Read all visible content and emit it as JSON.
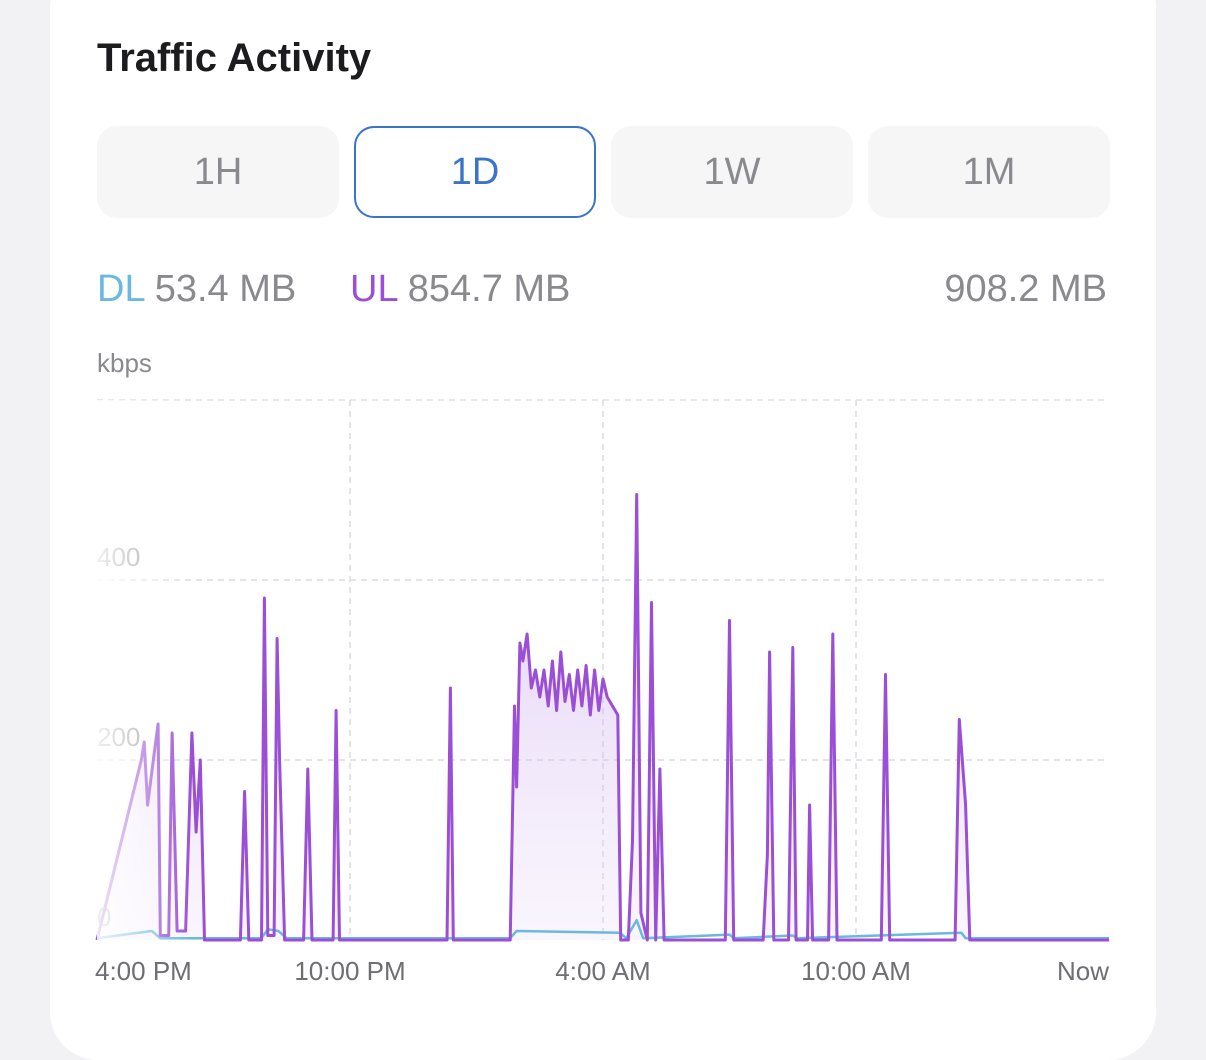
{
  "title": "Traffic Activity",
  "ranges": [
    {
      "label": "1H",
      "active": false
    },
    {
      "label": "1D",
      "active": true
    },
    {
      "label": "1W",
      "active": false
    },
    {
      "label": "1M",
      "active": false
    }
  ],
  "stats": {
    "dl_label": "DL",
    "dl_value": "53.4 MB",
    "ul_label": "UL",
    "ul_value": "854.7 MB",
    "total": "908.2 MB"
  },
  "colors": {
    "download": "#6bb8e0",
    "upload": "#9b4fd6",
    "active": "#3a74c9"
  },
  "chart_data": {
    "type": "area",
    "ylabel": "kbps",
    "ylim": [
      0,
      600
    ],
    "yticks": [
      0,
      200,
      400
    ],
    "xticks": [
      "4:00 PM",
      "10:00 PM",
      "4:00 AM",
      "10:00 AM",
      "Now"
    ],
    "xlim": [
      -1,
      23
    ],
    "series": [
      {
        "name": "UL",
        "points": [
          [
            -1.0,
            0
          ],
          [
            0.05,
            200
          ],
          [
            0.12,
            220
          ],
          [
            0.2,
            150
          ],
          [
            0.35,
            205
          ],
          [
            0.45,
            240
          ],
          [
            0.5,
            5
          ],
          [
            0.7,
            5
          ],
          [
            0.78,
            230
          ],
          [
            0.9,
            10
          ],
          [
            1.1,
            10
          ],
          [
            1.25,
            230
          ],
          [
            1.35,
            120
          ],
          [
            1.45,
            200
          ],
          [
            1.55,
            0
          ],
          [
            2.4,
            0
          ],
          [
            2.5,
            165
          ],
          [
            2.6,
            0
          ],
          [
            2.9,
            0
          ],
          [
            2.97,
            380
          ],
          [
            3.05,
            5
          ],
          [
            3.2,
            5
          ],
          [
            3.27,
            335
          ],
          [
            3.33,
            200
          ],
          [
            3.45,
            0
          ],
          [
            3.9,
            0
          ],
          [
            4.0,
            190
          ],
          [
            4.1,
            0
          ],
          [
            4.6,
            0
          ],
          [
            4.67,
            255
          ],
          [
            4.75,
            0
          ],
          [
            7.3,
            0
          ],
          [
            7.38,
            280
          ],
          [
            7.45,
            0
          ],
          [
            8.8,
            0
          ],
          [
            8.9,
            260
          ],
          [
            8.95,
            170
          ],
          [
            9.03,
            330
          ],
          [
            9.1,
            310
          ],
          [
            9.2,
            340
          ],
          [
            9.3,
            280
          ],
          [
            9.4,
            300
          ],
          [
            9.5,
            270
          ],
          [
            9.6,
            300
          ],
          [
            9.7,
            260
          ],
          [
            9.8,
            310
          ],
          [
            9.9,
            255
          ],
          [
            10.0,
            320
          ],
          [
            10.1,
            265
          ],
          [
            10.2,
            295
          ],
          [
            10.3,
            255
          ],
          [
            10.4,
            300
          ],
          [
            10.5,
            260
          ],
          [
            10.6,
            305
          ],
          [
            10.7,
            250
          ],
          [
            10.8,
            300
          ],
          [
            10.9,
            255
          ],
          [
            11.0,
            290
          ],
          [
            11.1,
            270
          ],
          [
            11.35,
            250
          ],
          [
            11.42,
            0
          ],
          [
            11.6,
            0
          ],
          [
            11.7,
            110
          ],
          [
            11.8,
            495
          ],
          [
            11.9,
            30
          ],
          [
            12.05,
            0
          ],
          [
            12.15,
            375
          ],
          [
            12.25,
            0
          ],
          [
            12.35,
            190
          ],
          [
            12.45,
            0
          ],
          [
            13.9,
            0
          ],
          [
            14.0,
            355
          ],
          [
            14.1,
            0
          ],
          [
            14.8,
            0
          ],
          [
            14.9,
            95
          ],
          [
            14.95,
            320
          ],
          [
            15.05,
            0
          ],
          [
            15.4,
            0
          ],
          [
            15.5,
            325
          ],
          [
            15.58,
            0
          ],
          [
            15.85,
            0
          ],
          [
            15.9,
            150
          ],
          [
            15.97,
            0
          ],
          [
            16.35,
            0
          ],
          [
            16.45,
            340
          ],
          [
            16.55,
            0
          ],
          [
            17.6,
            0
          ],
          [
            17.7,
            295
          ],
          [
            17.8,
            0
          ],
          [
            19.35,
            0
          ],
          [
            19.45,
            245
          ],
          [
            19.6,
            150
          ],
          [
            19.7,
            0
          ],
          [
            23.0,
            0
          ]
        ]
      },
      {
        "name": "DL",
        "points": [
          [
            -1.0,
            2
          ],
          [
            0.3,
            10
          ],
          [
            0.5,
            2
          ],
          [
            2.9,
            2
          ],
          [
            3.05,
            12
          ],
          [
            3.3,
            10
          ],
          [
            3.5,
            2
          ],
          [
            8.8,
            2
          ],
          [
            8.95,
            10
          ],
          [
            11.4,
            8
          ],
          [
            11.55,
            2
          ],
          [
            11.8,
            22
          ],
          [
            11.95,
            2
          ],
          [
            14.0,
            6
          ],
          [
            14.1,
            2
          ],
          [
            15.5,
            5
          ],
          [
            15.6,
            2
          ],
          [
            19.5,
            8
          ],
          [
            19.6,
            2
          ],
          [
            23.0,
            2
          ]
        ]
      }
    ]
  }
}
